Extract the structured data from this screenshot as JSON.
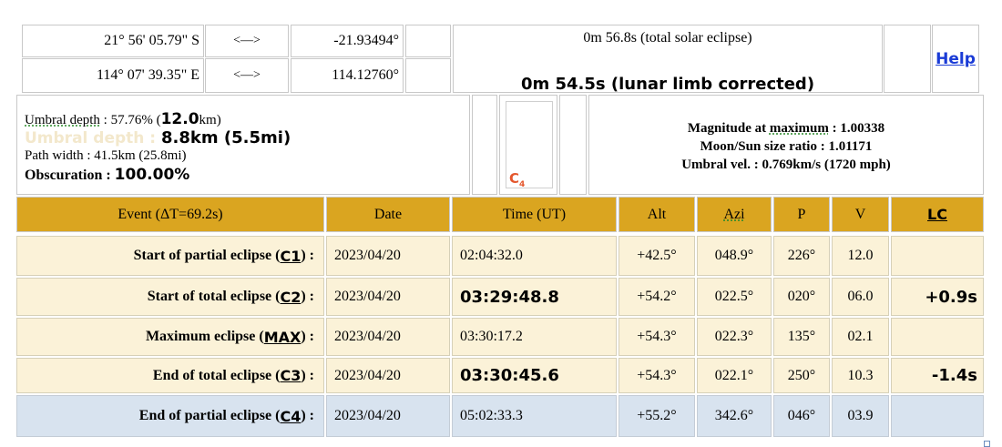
{
  "coords": {
    "lat_dms": "21° 56' 05.79\" S",
    "lat_arrow": "<—>",
    "lat_dec": "-21.93494°",
    "lon_dms": "114° 07' 39.35\" E",
    "lon_arrow": "<—>",
    "lon_dec": "114.12760°"
  },
  "duration": {
    "total": "0m 56.8s (total solar eclipse)",
    "corrected": "0m 54.5s (lunar limb corrected)"
  },
  "help_label": "Help",
  "depth": {
    "umbral_label": "Umbral depth",
    "umbral_sep": " : 57.76% (",
    "umbral_km": "12.0",
    "umbral_unit": "km)",
    "ghost_label": "Umbral depth : ",
    "ghost_value": "8.8km (5.5mi)",
    "path_width": "Path width : 41.5km (25.8mi)",
    "obscuration_label": "Obscuration : ",
    "obscuration_value": "100.00%"
  },
  "contact_marker": "C",
  "contact_marker_sub": "4",
  "magnitude": {
    "mag_label": "Magnitude at",
    "mag_word": "maximum",
    "mag_value": " : 1.00338",
    "ratio": "Moon/Sun size ratio : 1.01171",
    "umbral_vel": "Umbral vel. : 0.769km/s (1720 mph)"
  },
  "table": {
    "headers": {
      "event": "Event (ΔT=69.2s)",
      "date": "Date",
      "time": "Time (UT)",
      "alt": "Alt",
      "azi": "Azi",
      "p": "P",
      "v": "V",
      "lc": "LC"
    },
    "rows": [
      {
        "label": "Start of partial eclipse (",
        "code": "C1",
        "tail": ") :",
        "date": "2023/04/20",
        "time": "02:04:32.0",
        "alt": "+42.5°",
        "azi": "048.9°",
        "p": "226°",
        "v": "12.0",
        "lc": ""
      },
      {
        "label": "Start of total eclipse (",
        "code": "C2",
        "tail": ") :",
        "date": "2023/04/20",
        "time": "03:29:48.8",
        "alt": "+54.2°",
        "azi": "022.5°",
        "p": "020°",
        "v": "06.0",
        "lc": "+0.9s"
      },
      {
        "label": "Maximum eclipse (",
        "code": "MAX",
        "tail": ") :",
        "date": "2023/04/20",
        "time": "03:30:17.2",
        "alt": "+54.3°",
        "azi": "022.3°",
        "p": "135°",
        "v": "02.1",
        "lc": ""
      },
      {
        "label": "End of total eclipse (",
        "code": "C3",
        "tail": ") :",
        "date": "2023/04/20",
        "time": "03:30:45.6",
        "alt": "+54.3°",
        "azi": "022.1°",
        "p": "250°",
        "v": "10.3",
        "lc": "-1.4s"
      },
      {
        "label": "End of partial eclipse (",
        "code": "C4",
        "tail": ") :",
        "date": "2023/04/20",
        "time": "05:02:33.3",
        "alt": "+55.2°",
        "azi": "342.6°",
        "p": "046°",
        "v": "03.9",
        "lc": ""
      }
    ]
  }
}
